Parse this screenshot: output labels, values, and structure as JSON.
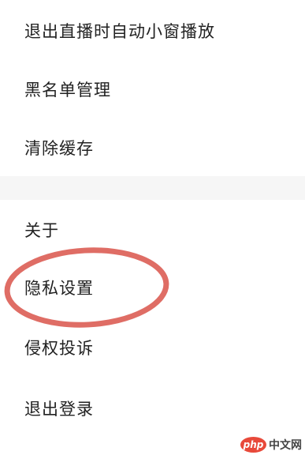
{
  "settings": {
    "items": [
      {
        "label": "退出直播时自动小窗播放"
      },
      {
        "label": "黑名单管理"
      },
      {
        "label": "清除缓存"
      },
      {
        "label": "关于"
      },
      {
        "label": "隐私设置"
      },
      {
        "label": "侵权投诉"
      },
      {
        "label": "退出登录"
      }
    ],
    "highlighted_item": "隐私设置",
    "highlight_color": "#d9534a"
  },
  "watermark": {
    "badge_text": "php",
    "site_text": "中文网"
  }
}
